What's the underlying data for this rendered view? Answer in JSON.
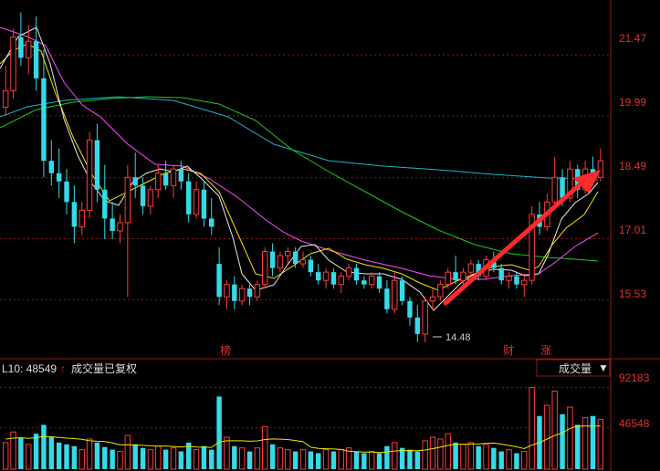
{
  "colors": {
    "up": "#ff3c3c",
    "down": "#36d9e8",
    "ma_white": "#e8e8e8",
    "ma_yellow": "#f2e400",
    "ma_magenta": "#ff4cff",
    "ma_green": "#1ec91e",
    "ma_cyan": "#1fb3c9",
    "arrow": "#ff2a2a",
    "grid": "#8b1a1a",
    "axis_text": "#e03030"
  },
  "price_axis": {
    "ticks": [
      "21.47",
      "19.99",
      "18.49",
      "17.01",
      "15.53"
    ],
    "tick_values": [
      21.47,
      19.99,
      18.49,
      17.01,
      15.53
    ],
    "ylim": [
      14.1,
      22.8
    ]
  },
  "volume_axis": {
    "ticks": [
      "92183",
      "46548"
    ],
    "tick_values": [
      92183,
      46548
    ],
    "ylim": [
      0,
      105000
    ]
  },
  "markers": {
    "low_label": "14.48",
    "tags": [
      "榜",
      "财",
      "涨"
    ]
  },
  "volume_panel": {
    "prefix": "L10: 48549",
    "arrow": "↑",
    "title": "成交量已复权",
    "selector_label": "成交量",
    "selector_icon": "▼"
  },
  "chart_data": {
    "type": "candlestick",
    "ylim": [
      14.1,
      22.8
    ],
    "ohlc": [
      [
        20.2,
        21.2,
        20.0,
        20.6
      ],
      [
        20.6,
        22.1,
        20.4,
        21.9
      ],
      [
        21.9,
        22.5,
        21.2,
        21.4
      ],
      [
        21.4,
        22.2,
        21.0,
        21.8
      ],
      [
        21.8,
        22.4,
        20.6,
        20.9
      ],
      [
        20.9,
        21.6,
        18.5,
        18.9
      ],
      [
        18.9,
        19.4,
        18.3,
        18.6
      ],
      [
        18.6,
        19.2,
        18.0,
        18.4
      ],
      [
        18.4,
        18.7,
        17.6,
        17.9
      ],
      [
        17.9,
        18.3,
        16.9,
        17.3
      ],
      [
        17.3,
        17.9,
        17.1,
        17.7
      ],
      [
        17.7,
        19.6,
        17.5,
        19.4
      ],
      [
        19.4,
        19.8,
        17.9,
        18.2
      ],
      [
        18.2,
        18.8,
        17.0,
        17.5
      ],
      [
        17.5,
        17.9,
        17.0,
        17.2
      ],
      [
        17.2,
        17.6,
        16.9,
        17.4
      ],
      [
        17.4,
        18.8,
        15.6,
        18.5
      ],
      [
        18.5,
        19.1,
        18.0,
        18.3
      ],
      [
        18.3,
        18.5,
        17.6,
        17.8
      ],
      [
        17.8,
        18.3,
        17.6,
        18.2
      ],
      [
        18.2,
        18.8,
        18.0,
        18.6
      ],
      [
        18.6,
        18.9,
        18.2,
        18.3
      ],
      [
        18.3,
        18.8,
        18.0,
        18.7
      ],
      [
        18.7,
        18.9,
        18.2,
        18.4
      ],
      [
        18.4,
        18.6,
        17.4,
        17.6
      ],
      [
        17.6,
        18.4,
        17.5,
        18.2
      ],
      [
        18.2,
        18.4,
        17.3,
        17.5
      ],
      [
        17.5,
        18.0,
        17.1,
        17.3
      ],
      [
        16.4,
        16.8,
        15.4,
        15.6
      ],
      [
        15.6,
        16.0,
        15.3,
        15.9
      ],
      [
        15.9,
        16.1,
        15.3,
        15.5
      ],
      [
        15.5,
        15.9,
        15.4,
        15.8
      ],
      [
        15.8,
        15.9,
        15.4,
        15.6
      ],
      [
        15.6,
        16.0,
        15.5,
        15.9
      ],
      [
        15.9,
        16.8,
        15.8,
        16.7
      ],
      [
        16.7,
        16.9,
        16.1,
        16.3
      ],
      [
        16.3,
        16.7,
        16.2,
        16.6
      ],
      [
        16.6,
        16.8,
        16.4,
        16.7
      ],
      [
        16.7,
        16.8,
        16.3,
        16.4
      ],
      [
        16.4,
        16.7,
        16.3,
        16.5
      ],
      [
        16.5,
        16.6,
        16.1,
        16.2
      ],
      [
        16.2,
        16.4,
        15.9,
        16.0
      ],
      [
        16.0,
        16.3,
        15.8,
        16.2
      ],
      [
        16.2,
        16.3,
        15.8,
        15.9
      ],
      [
        15.9,
        16.2,
        15.7,
        16.1
      ],
      [
        16.1,
        16.4,
        16.0,
        16.3
      ],
      [
        16.3,
        16.4,
        15.9,
        16.0
      ],
      [
        16.0,
        16.1,
        15.8,
        15.9
      ],
      [
        15.9,
        16.2,
        15.8,
        16.1
      ],
      [
        16.1,
        16.2,
        15.7,
        15.8
      ],
      [
        15.8,
        16.0,
        15.2,
        15.3
      ],
      [
        15.3,
        16.2,
        15.2,
        16.0
      ],
      [
        16.0,
        16.1,
        15.4,
        15.5
      ],
      [
        15.5,
        15.6,
        14.9,
        15.1
      ],
      [
        15.1,
        15.4,
        14.5,
        14.7
      ],
      [
        14.7,
        15.6,
        14.5,
        15.5
      ],
      [
        15.5,
        15.8,
        15.3,
        15.6
      ],
      [
        15.6,
        16.0,
        15.5,
        15.9
      ],
      [
        15.9,
        16.3,
        15.8,
        16.2
      ],
      [
        16.2,
        16.6,
        15.9,
        16.0
      ],
      [
        16.0,
        16.3,
        15.9,
        16.2
      ],
      [
        16.2,
        16.5,
        16.1,
        16.4
      ],
      [
        16.4,
        16.5,
        16.0,
        16.1
      ],
      [
        16.1,
        16.6,
        16.0,
        16.5
      ],
      [
        16.5,
        16.7,
        16.2,
        16.3
      ],
      [
        16.3,
        16.4,
        15.9,
        16.0
      ],
      [
        16.0,
        16.2,
        15.8,
        16.1
      ],
      [
        16.1,
        16.2,
        15.8,
        15.9
      ],
      [
        15.9,
        16.1,
        15.6,
        16.0
      ],
      [
        16.0,
        17.8,
        15.9,
        17.6
      ],
      [
        17.6,
        17.9,
        17.1,
        17.3
      ],
      [
        17.3,
        18.1,
        17.2,
        17.9
      ],
      [
        17.9,
        19.0,
        17.7,
        18.5
      ],
      [
        18.5,
        18.7,
        17.8,
        18.0
      ],
      [
        18.0,
        18.9,
        17.9,
        18.7
      ],
      [
        18.7,
        18.8,
        18.0,
        18.2
      ],
      [
        18.2,
        18.9,
        18.1,
        18.7
      ],
      [
        18.7,
        19.0,
        18.3,
        18.5
      ],
      [
        18.5,
        19.2,
        18.4,
        18.9
      ]
    ],
    "volume": [
      30000,
      42000,
      35000,
      28000,
      40000,
      50000,
      36000,
      30000,
      28000,
      26000,
      22000,
      34000,
      30000,
      25000,
      22000,
      20000,
      38000,
      28000,
      24000,
      22000,
      26000,
      22000,
      24000,
      20000,
      30000,
      22000,
      26000,
      22000,
      82000,
      36000,
      26000,
      24000,
      20000,
      24000,
      48000,
      28000,
      24000,
      22000,
      20000,
      22000,
      20000,
      18000,
      22000,
      20000,
      22000,
      24000,
      20000,
      18000,
      20000,
      18000,
      26000,
      30000,
      24000,
      22000,
      20000,
      32000,
      36000,
      34000,
      40000,
      30000,
      28000,
      30000,
      26000,
      28000,
      24000,
      20000,
      22000,
      18000,
      20000,
      92000,
      60000,
      72000,
      88000,
      62000,
      70000,
      50000,
      58000,
      60000,
      56000
    ],
    "ma_volume": {
      "name": "L10",
      "values": [
        34000,
        35000,
        35500,
        34800,
        35500,
        37000,
        36500,
        35800,
        35000,
        34500,
        33700,
        32000,
        31500,
        31200,
        29800,
        27400,
        27600,
        27400,
        26800,
        26400,
        25800,
        26100,
        25500,
        25000,
        25800,
        25000,
        24800,
        24600,
        30600,
        32000,
        32000,
        32000,
        31500,
        31900,
        33500,
        34100,
        33900,
        33500,
        32300,
        31000,
        24800,
        23500,
        23100,
        22700,
        22200,
        20200,
        19800,
        19400,
        19400,
        18800,
        19400,
        20600,
        20800,
        21000,
        20800,
        21600,
        23200,
        24800,
        26800,
        28000,
        28200,
        28200,
        28400,
        29000,
        29400,
        28200,
        26800,
        25200,
        23200,
        27200,
        30000,
        34000,
        38000,
        41000,
        46000,
        48549,
        48549,
        48549,
        48549
      ]
    }
  }
}
